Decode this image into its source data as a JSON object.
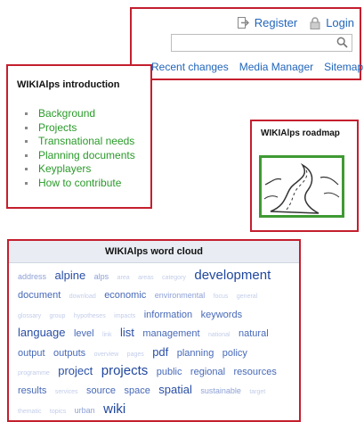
{
  "header": {
    "register_label": "Register",
    "login_label": "Login",
    "search_placeholder": "",
    "nav": [
      "Recent changes",
      "Media Manager",
      "Sitemap"
    ],
    "accent_color": "#c41f2e",
    "link_color": "#2266bb"
  },
  "intro": {
    "title": "WIKIAlps introduction",
    "items": [
      "Background",
      "Projects",
      "Transnational needs",
      "Planning documents",
      "Keyplayers",
      "How to contribute"
    ]
  },
  "roadmap": {
    "title": "WIKIAlps roadmap",
    "image_icon": "road-icon"
  },
  "cloud": {
    "title": "WIKIAlps word cloud",
    "tags": [
      {
        "text": "address",
        "w": 2
      },
      {
        "text": "alpine",
        "w": 4
      },
      {
        "text": "alps",
        "w": 2
      },
      {
        "text": "area",
        "w": 1
      },
      {
        "text": "areas",
        "w": 1
      },
      {
        "text": "category",
        "w": 1
      },
      {
        "text": "development",
        "w": 5
      },
      {
        "text": "document",
        "w": 3
      },
      {
        "text": "download",
        "w": 1
      },
      {
        "text": "economic",
        "w": 3
      },
      {
        "text": "environmental",
        "w": 2
      },
      {
        "text": "focus",
        "w": 1
      },
      {
        "text": "general",
        "w": 1
      },
      {
        "text": "glossary",
        "w": 1
      },
      {
        "text": "group",
        "w": 1
      },
      {
        "text": "hypotheses",
        "w": 1
      },
      {
        "text": "impacts",
        "w": 1
      },
      {
        "text": "information",
        "w": 3
      },
      {
        "text": "keywords",
        "w": 3
      },
      {
        "text": "language",
        "w": 4
      },
      {
        "text": "level",
        "w": 3
      },
      {
        "text": "link",
        "w": 1
      },
      {
        "text": "list",
        "w": 4
      },
      {
        "text": "management",
        "w": 3
      },
      {
        "text": "national",
        "w": 1
      },
      {
        "text": "natural",
        "w": 3
      },
      {
        "text": "output",
        "w": 3
      },
      {
        "text": "outputs",
        "w": 3
      },
      {
        "text": "overview",
        "w": 1
      },
      {
        "text": "pages",
        "w": 1
      },
      {
        "text": "pdf",
        "w": 4
      },
      {
        "text": "planning",
        "w": 3
      },
      {
        "text": "policy",
        "w": 3
      },
      {
        "text": "programme",
        "w": 1
      },
      {
        "text": "project",
        "w": 4
      },
      {
        "text": "projects",
        "w": 5
      },
      {
        "text": "public",
        "w": 3
      },
      {
        "text": "regional",
        "w": 3
      },
      {
        "text": "resources",
        "w": 3
      },
      {
        "text": "results",
        "w": 3
      },
      {
        "text": "services",
        "w": 1
      },
      {
        "text": "source",
        "w": 3
      },
      {
        "text": "space",
        "w": 3
      },
      {
        "text": "spatial",
        "w": 4
      },
      {
        "text": "sustainable",
        "w": 2
      },
      {
        "text": "target",
        "w": 1
      },
      {
        "text": "thematic",
        "w": 1
      },
      {
        "text": "topics",
        "w": 1
      },
      {
        "text": "urban",
        "w": 2
      },
      {
        "text": "wiki",
        "w": 5
      }
    ]
  }
}
